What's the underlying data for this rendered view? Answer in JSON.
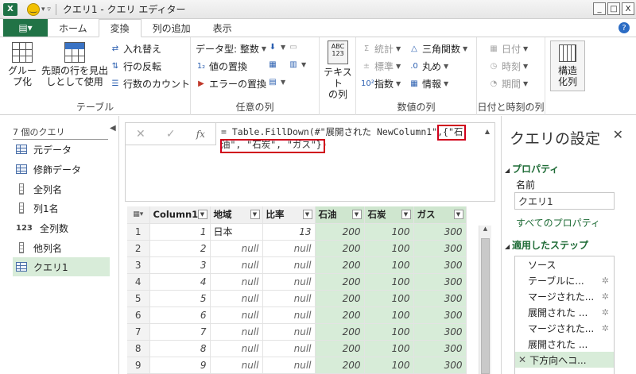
{
  "window": {
    "title": "クエリ1 - クエリ エディター",
    "app_icon": "X",
    "controls": [
      "_",
      "□",
      "X"
    ]
  },
  "tabs": {
    "file": "▤▾",
    "items": [
      "ホーム",
      "変換",
      "列の追加",
      "表示"
    ],
    "active": "変換",
    "help": "?"
  },
  "ribbon": {
    "table_group": {
      "label": "テーブル",
      "group_by": "グループ化",
      "group_by_l1": "グルー",
      "group_by_l2": "プ化",
      "first_row_l1": "先頭の行を見出",
      "first_row_l2": "しとして使用",
      "swap": "入れ替え",
      "reverse_rows": "行の反転",
      "count_rows": "行数のカウント"
    },
    "any_column_group": {
      "label": "任意の列",
      "data_type": "データ型: 整数",
      "replace_values": "値の置換",
      "replace_errors": "エラーの置換"
    },
    "text_column": {
      "l1": "テキスト",
      "l2": "の列"
    },
    "number_column_group": {
      "label": "数値の列",
      "statistics": "統計",
      "standard": "標準",
      "scientific": "指数",
      "trigonometry": "三角関数",
      "rounding": "丸め",
      "information": "情報"
    },
    "datetime_group": {
      "label": "日付と時刻の列",
      "date": "日付",
      "time": "時刻",
      "duration": "期間"
    },
    "structured": {
      "l1": "構造",
      "l2": "化列"
    }
  },
  "queries_pane": {
    "count_label": "7 個のクエリ",
    "items": [
      {
        "label": "元データ",
        "icon": "table-icon"
      },
      {
        "label": "修飾データ",
        "icon": "table-icon"
      },
      {
        "label": "全列名",
        "icon": "column-icon"
      },
      {
        "label": "列1名",
        "icon": "column-icon"
      },
      {
        "label": "全列数",
        "icon": "number-icon",
        "prefix": "123"
      },
      {
        "label": "他列名",
        "icon": "column-icon"
      },
      {
        "label": "クエリ1",
        "icon": "table-icon",
        "active": true
      }
    ]
  },
  "formula": {
    "line1": "= Table.FillDown(#\"展開された NewColumn1\",{\"石",
    "line2": "油\", \"石炭\", \"ガス\"})"
  },
  "grid": {
    "columns": [
      {
        "name": "Column1",
        "highlight": false
      },
      {
        "name": "地域",
        "highlight": false
      },
      {
        "name": "比率",
        "highlight": false
      },
      {
        "name": "石油",
        "highlight": true
      },
      {
        "name": "石炭",
        "highlight": true
      },
      {
        "name": "ガス",
        "highlight": true
      }
    ],
    "rows": [
      [
        "1",
        "1",
        "日本",
        "13",
        "200",
        "100",
        "300"
      ],
      [
        "2",
        "2",
        "null",
        "null",
        "200",
        "100",
        "300"
      ],
      [
        "3",
        "3",
        "null",
        "null",
        "200",
        "100",
        "300"
      ],
      [
        "4",
        "4",
        "null",
        "null",
        "200",
        "100",
        "300"
      ],
      [
        "5",
        "5",
        "null",
        "null",
        "200",
        "100",
        "300"
      ],
      [
        "6",
        "6",
        "null",
        "null",
        "200",
        "100",
        "300"
      ],
      [
        "7",
        "7",
        "null",
        "null",
        "200",
        "100",
        "300"
      ],
      [
        "8",
        "8",
        "null",
        "null",
        "200",
        "100",
        "300"
      ],
      [
        "9",
        "9",
        "null",
        "null",
        "200",
        "100",
        "300"
      ]
    ]
  },
  "settings_pane": {
    "title": "クエリの設定",
    "properties_header": "プロパティ",
    "name_label": "名前",
    "name_value": "クエリ1",
    "all_properties": "すべてのプロパティ",
    "steps_header": "適用したステップ",
    "steps": [
      {
        "label": "ソース",
        "gear": false
      },
      {
        "label": "テーブルに...",
        "gear": true
      },
      {
        "label": "マージされた...",
        "gear": true
      },
      {
        "label": "展開された ...",
        "gear": true
      },
      {
        "label": "マージされた...",
        "gear": true
      },
      {
        "label": "展開された ...",
        "gear": false
      },
      {
        "label": "下方向へコ...",
        "gear": false,
        "active": true
      }
    ]
  }
}
